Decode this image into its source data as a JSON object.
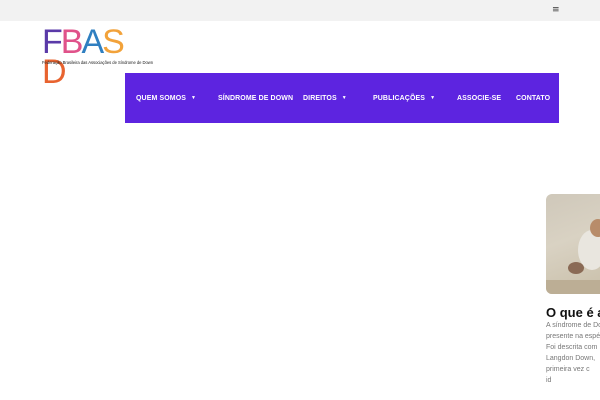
{
  "topbar": {
    "menu_icon": "menu-icon"
  },
  "logo": {
    "letters": [
      {
        "char": "F",
        "color": "#5a3aa8"
      },
      {
        "char": "B",
        "color": "#e0528a"
      },
      {
        "char": "A",
        "color": "#2f7fc1"
      },
      {
        "char": "S",
        "color": "#f2a23a"
      },
      {
        "char": "D",
        "color": "#e8632f"
      }
    ],
    "subtitle": "Federação Brasileira das Associações de Síndrome de Down"
  },
  "nav": {
    "background": "#5d24e0",
    "items": [
      {
        "label": "Quem Somos",
        "dropdown": true
      },
      {
        "label": "Síndrome de Down",
        "dropdown": false
      },
      {
        "label": "Direitos",
        "dropdown": true
      },
      {
        "label": "Publicações",
        "dropdown": true
      },
      {
        "label": "Associe-se",
        "dropdown": false
      },
      {
        "label": "Contato",
        "dropdown": false
      }
    ]
  },
  "card": {
    "title": "O que é a S",
    "lines": [
      "A síndrome de Do",
      "presente na espé",
      "Foi descrita com",
      "Langdon Down,",
      "primeira vez c",
      "id"
    ]
  }
}
